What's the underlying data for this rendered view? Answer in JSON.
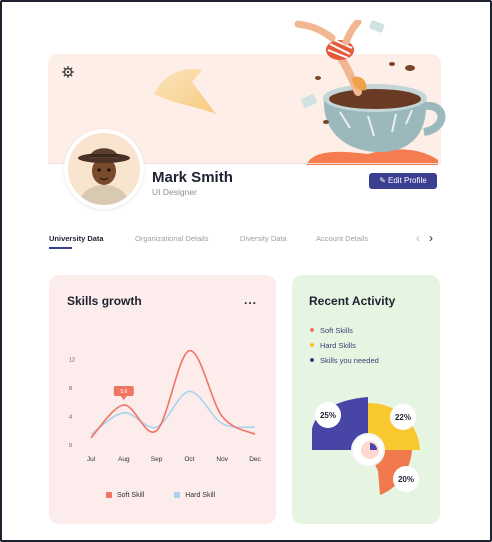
{
  "profile": {
    "name": "Mark Smith",
    "role": "UI Designer",
    "edit_label": "Edit Profile"
  },
  "tabs": [
    {
      "label": "University Data",
      "active": true
    },
    {
      "label": "Organizational Details",
      "active": false
    },
    {
      "label": "Diversity Data",
      "active": false
    },
    {
      "label": "Account Details",
      "active": false
    }
  ],
  "skills_card": {
    "title": "Skills growth",
    "more": "..."
  },
  "activity_card": {
    "title": "Recent Activity",
    "items": [
      {
        "label": "Soft Skills",
        "color": "#f07464"
      },
      {
        "label": "Hard Skills",
        "color": "#f7c52c"
      },
      {
        "label": "Skills you needed",
        "color": "#3b3f92"
      }
    ],
    "percent_labels": [
      "25%",
      "22%",
      "20%"
    ]
  },
  "colors": {
    "accent": "#3b3f92",
    "soft": "#f07464",
    "hard": "#a9d3ec",
    "banner": "#fdeee7"
  },
  "chart_data": {
    "type": "line",
    "categories": [
      "Jul",
      "Aug",
      "Sep",
      "Oct",
      "Nov",
      "Dec"
    ],
    "yticks": [
      0,
      4,
      8,
      12
    ],
    "ylim": [
      0,
      14
    ],
    "series": [
      {
        "name": "Soft Skill",
        "values": [
          1,
          5.6,
          2,
          13.2,
          4,
          1.5
        ],
        "color": "#f07464"
      },
      {
        "name": "Hard Skill",
        "values": [
          1.5,
          4.5,
          2.5,
          7.5,
          3,
          2.5
        ],
        "color": "#a9d3ec"
      }
    ],
    "annotation": "5.6"
  }
}
